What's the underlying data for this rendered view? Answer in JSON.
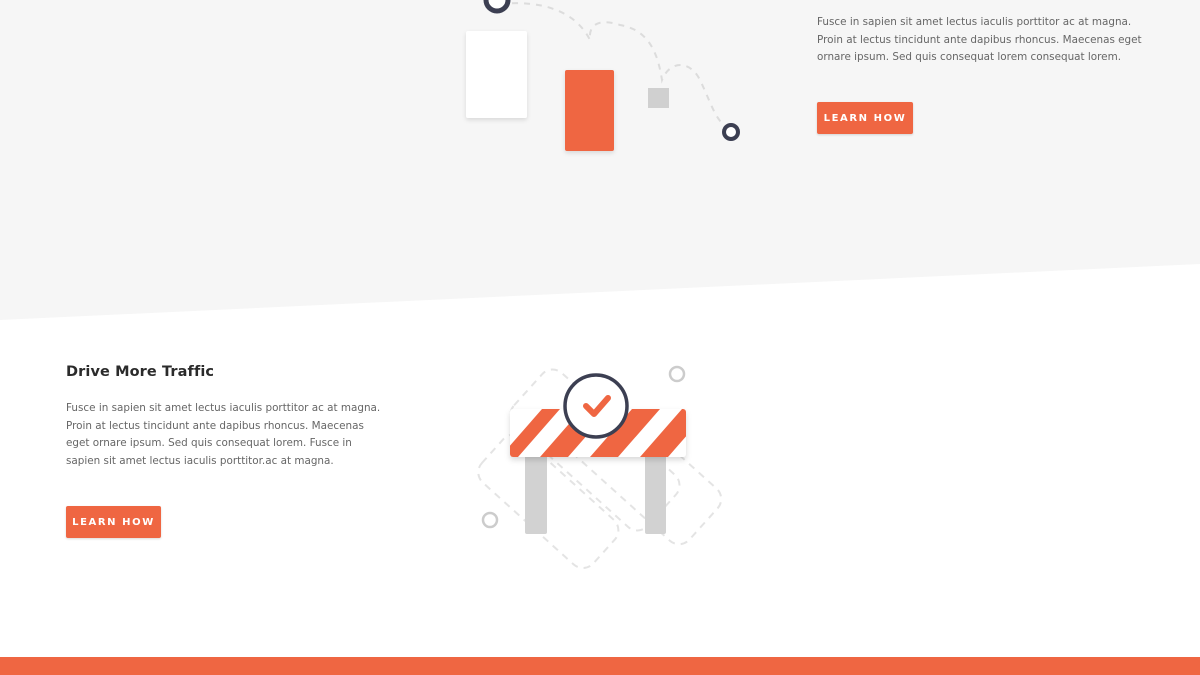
{
  "top_section": {
    "description": "Fusce in sapien sit amet lectus iaculis porttitor ac at magna. Proin at lectus tincidunt ante dapibus rhoncus. Maecenas eget ornare ipsum. Sed quis consequat lorem consequat lorem.",
    "button_label": "LEARN HOW"
  },
  "feature_section": {
    "title": "Drive More Traffic",
    "description": "Fusce in sapien sit amet lectus iaculis porttitor ac at magna. Proin at lectus tincidunt ante dapibus rhoncus. Maecenas eget ornare ipsum. Sed quis consequat lorem. Fusce in sapien sit amet lectus iaculis porttitor.ac at magna.",
    "button_label": "LEARN HOW"
  },
  "colors": {
    "accent": "#ef6642",
    "navy": "#3c3f52",
    "light_gray_bg": "#f6f6f6",
    "text_gray": "#666666",
    "heading": "#2b2b2b"
  },
  "icons": [
    "flow-path-illustration",
    "road-barrier-illustration",
    "checkmark-icon"
  ]
}
